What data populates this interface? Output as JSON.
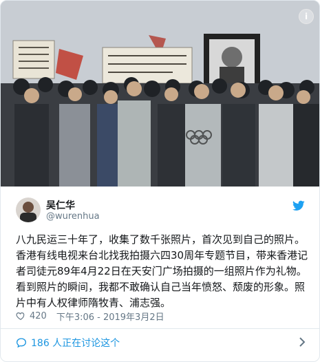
{
  "tweet": {
    "display_name": "吴仁华",
    "handle": "@wurenhua",
    "text": "八九民运三十年了，收集了数千张照片，首次见到自己的照片。香港有线电视来台北找我拍摄六四30周年专题节目，带来香港记者司徒元89年4月22日在天安门广场拍摄的一组照片作为礼物。看到照片的瞬间，我都不敢确认自己当年愤怒、颓废的形象。照片中有人权律师隋牧青、浦志强。",
    "like_count": "420",
    "timestamp": "下午3:06 - 2019年3月2日",
    "discussion": "186 人正在讨论这个"
  },
  "icons": {
    "info": "info-icon",
    "brand": "twitter-bird-icon",
    "like": "heart-icon",
    "reply": "speech-bubble-icon",
    "more": "chevron-right-icon"
  },
  "colors": {
    "brand_blue": "#1da1f2",
    "link_blue": "#1b95e0",
    "text": "#14171a",
    "muted": "#657786",
    "border": "#e1e8ed"
  }
}
